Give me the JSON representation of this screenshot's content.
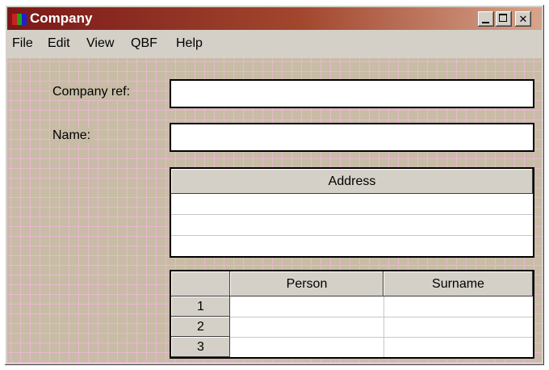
{
  "window": {
    "title": "Company"
  },
  "menu": [
    "File",
    "Edit",
    "View",
    "QBF",
    "Help"
  ],
  "form": {
    "company_ref_label": "Company ref:",
    "company_ref_value": "",
    "name_label": "Name:",
    "name_value": ""
  },
  "address_table": {
    "header": "Address",
    "rows": [
      "",
      "",
      ""
    ]
  },
  "person_table": {
    "columns": [
      "",
      "Person",
      "Surname"
    ],
    "rows": [
      {
        "num": "1",
        "person": "",
        "surname": ""
      },
      {
        "num": "2",
        "person": "",
        "surname": ""
      },
      {
        "num": "3",
        "person": "",
        "surname": ""
      }
    ]
  },
  "colors": {
    "titlebar_start": "#7a1818",
    "titlebar_end": "#d6a48c",
    "form_background": "#c8bca6",
    "grid_lines": "#e9b8cf"
  }
}
